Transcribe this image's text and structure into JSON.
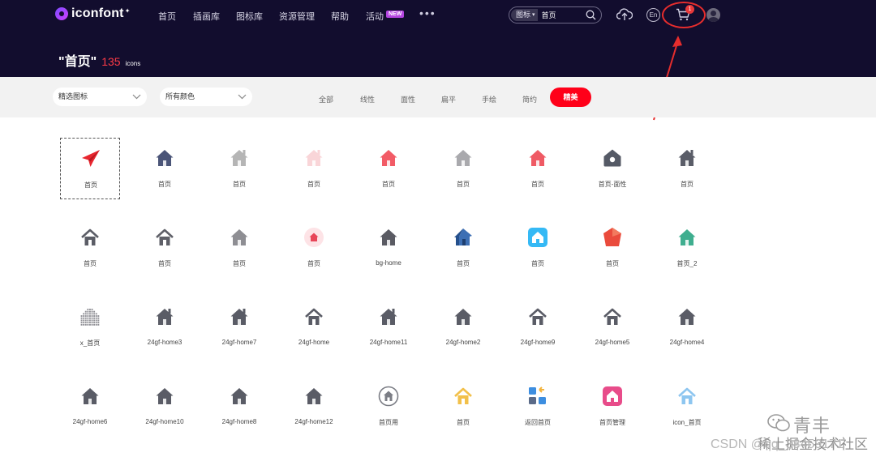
{
  "nav": {
    "logo": "iconfont",
    "links": [
      "首页",
      "插画库",
      "图标库",
      "资源管理",
      "帮助",
      "活动"
    ],
    "new_badge": "NEW",
    "more": "•••",
    "search_type": "图标",
    "search_value": "首页",
    "lang": "En",
    "cart_count": "1"
  },
  "page": {
    "query": "\"首页\"",
    "count": "135",
    "unit": "icons"
  },
  "filters": {
    "icon_select": "精选图标",
    "color_select": "所有颜色",
    "tabs": [
      "全部",
      "线性",
      "面性",
      "扁平",
      "手绘",
      "简约"
    ],
    "active_tab": "精美"
  },
  "icons": [
    {
      "label": "首页",
      "icon": "paper-plane-icon",
      "color": "#e8262f"
    },
    {
      "label": "首页",
      "icon": "home-icon",
      "color": "#4b5578"
    },
    {
      "label": "首页",
      "icon": "home-chimney-icon",
      "color": "#b5b5b5"
    },
    {
      "label": "首页",
      "icon": "home-chimney-icon",
      "color": "#f9d5d8"
    },
    {
      "label": "首页",
      "icon": "home-icon",
      "color": "#f25b66"
    },
    {
      "label": "首页",
      "icon": "home-icon",
      "color": "#a9a9ad"
    },
    {
      "label": "首页",
      "icon": "home-icon",
      "color": "#ef5a64"
    },
    {
      "label": "首页-面性",
      "icon": "home-round-icon",
      "color": "#555a66"
    },
    {
      "label": "首页",
      "icon": "home-chimney-icon",
      "color": "#5a5d68"
    },
    {
      "label": "首页",
      "icon": "home-outline-icon",
      "color": "#5b5d66"
    },
    {
      "label": "首页",
      "icon": "home-outline-icon",
      "color": "#5f6068"
    },
    {
      "label": "首页",
      "icon": "home-icon",
      "color": "#8e8e93"
    },
    {
      "label": "首页",
      "icon": "home-circle-icon",
      "color": "#e84558"
    },
    {
      "label": "bg-home",
      "icon": "home-icon",
      "color": "#5a5b63"
    },
    {
      "label": "首页",
      "icon": "home-3d-icon",
      "color": "#3d6fb4"
    },
    {
      "label": "首页",
      "icon": "home-square-icon",
      "color": "#35b9f5"
    },
    {
      "label": "首页",
      "icon": "home-hex-icon",
      "color": "#ea4b3c"
    },
    {
      "label": "首页_2",
      "icon": "home-icon",
      "color": "#3fae8f"
    },
    {
      "label": "x_首页",
      "icon": "home-dots-icon",
      "color": "#8f8f95"
    },
    {
      "label": "24gf-home3",
      "icon": "home-chimney-icon",
      "color": "#5a5c66"
    },
    {
      "label": "24gf-home7",
      "icon": "home-chimney-icon",
      "color": "#5a5c66"
    },
    {
      "label": "24gf-home",
      "icon": "home-outline-icon",
      "color": "#5a5c66"
    },
    {
      "label": "24gf-home11",
      "icon": "home-chimney-icon",
      "color": "#5a5c66"
    },
    {
      "label": "24gf-home2",
      "icon": "home-icon",
      "color": "#5a5c66"
    },
    {
      "label": "24gf-home9",
      "icon": "home-outline-icon",
      "color": "#5a5c66"
    },
    {
      "label": "24gf-home5",
      "icon": "home-outline-icon",
      "color": "#5a5c66"
    },
    {
      "label": "24gf-home4",
      "icon": "home-icon",
      "color": "#5a5c66"
    },
    {
      "label": "24gf-home6",
      "icon": "home-icon",
      "color": "#5a5c66"
    },
    {
      "label": "24gf-home10",
      "icon": "home-icon",
      "color": "#5a5c66"
    },
    {
      "label": "24gf-home8",
      "icon": "home-icon",
      "color": "#5a5c66"
    },
    {
      "label": "24gf-home12",
      "icon": "home-icon",
      "color": "#5a5c66"
    },
    {
      "label": "首页用",
      "icon": "home-ring-icon",
      "color": "#7b7d85"
    },
    {
      "label": "首页",
      "icon": "home-outline-icon",
      "color": "#f2c04a"
    },
    {
      "label": "返回首页",
      "icon": "grid-apps-icon",
      "color": "#3d8ee0"
    },
    {
      "label": "首页管理",
      "icon": "home-square-icon",
      "color": "#e84c8a"
    },
    {
      "label": "icon_首页",
      "icon": "home-outline-icon",
      "color": "#8ec6f0"
    }
  ],
  "watermarks": {
    "wechat_name": "青丰",
    "wechat_sub": "稀土掘金技术社区",
    "csdn": "CSDN @qq_38459171"
  }
}
